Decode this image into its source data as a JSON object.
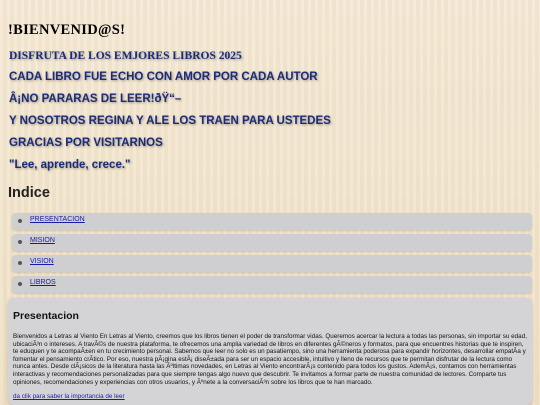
{
  "header": {
    "title": "!BIENVENID@S!",
    "taglines": [
      "DISFRUTA DE LOS EMJORES LIBROS 2025",
      "CADA LIBRO FUE ECHO CON AMOR POR CADA AUTOR",
      "Â¡NO PARARAS DE LEER!ðŸ“–",
      "Y NOSOTROS REGINA Y ALE LOS TRAEN PARA USTEDES",
      "GRACIAS POR VISITARNOS",
      "\"Lee, aprende, crece.\""
    ]
  },
  "index": {
    "heading": "Indice",
    "items": [
      "PRESENTACION",
      "MISION",
      "VISION",
      "LIBROS"
    ]
  },
  "presentacion": {
    "heading": "Presentacion",
    "body": "Bienvenidos a Letras al Viento En Letras al Viento, creemos que los libros tienen el poder de transformar vidas. Queremos acercar la lectura a todas las personas, sin importar su edad, ubicaciÃ³n o intereses. A travÃ©s de nuestra plataforma, te ofrecemos una amplia variedad de libros en diferentes gÃ©neros y formatos, para que encuentres historias que te inspiren, te eduquen y te acompaÃ±en en tu crecimiento personal. Sabemos que leer no solo es un pasatiempo, sino una herramienta poderosa para expandir horizontes, desarrollar empatÃ­a y fomentar el pensamiento crÃ­tico. Por eso, nuestra pÃ¡gina estÃ¡ diseÃ±ada para ser un espacio accesible, intuitivo y lleno de recursos que te permitan disfrutar de la lectura como nunca antes. Desde clÃ¡sicos de la literatura hasta las Ãºltimas novedades, en Letras al Viento encontrarÃ¡s contenido para todos los gustos. AdemÃ¡s, contamos con herramientas interactivas y recomendaciones personalizadas para que siempre tengas algo nuevo que descubrir. Te invitamos a formar parte de nuestra comunidad de lectores. Comparte tus opiniones, recomendaciones y experiencias con otros usuarios, y Ãºnete a la conversaciÃ³n sobre los libros que te han marcado.",
    "link": "da clik para saber la importancia de leer"
  }
}
